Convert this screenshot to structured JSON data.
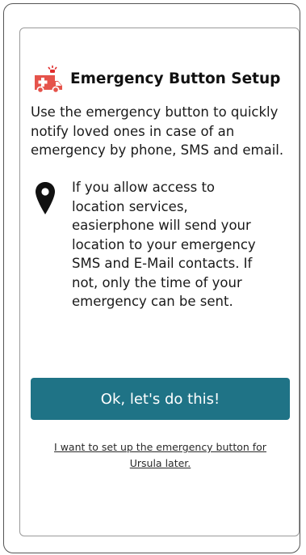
{
  "header": {
    "icon": "ambulance-icon",
    "title": "Emergency Button Setup"
  },
  "intro": {
    "text": "Use the emergency button to quickly notify loved ones in case of an emergency by phone, SMS and email."
  },
  "location_info": {
    "icon": "location-pin-icon",
    "text": "If you allow access to location services, easierphone will send your location to your emergency SMS and E-Mail contacts. If not, only the time of your emergency can be sent."
  },
  "actions": {
    "confirm_label": "Ok, let's do this!",
    "later_label": "I want to set up the emergency button for Ursula later."
  },
  "colors": {
    "primary_button": "#1f7386",
    "ambulance_red": "#e5534b",
    "siren_red": "#e02d2d"
  }
}
